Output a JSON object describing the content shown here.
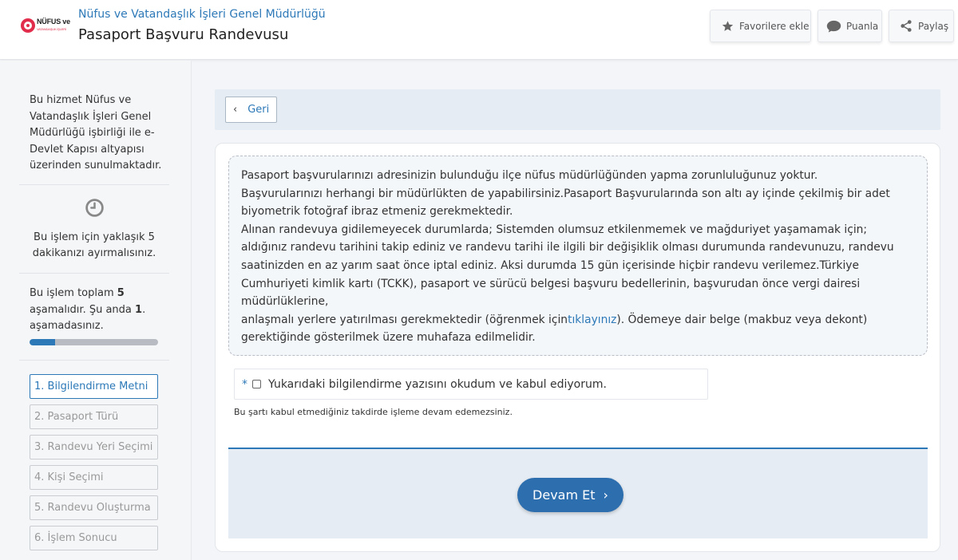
{
  "header": {
    "logo_text": "NÜFUS ve",
    "logo_sub": "VATANDAŞLIK İŞLERİ",
    "org": "Nüfus ve Vatandaşlık İşleri Genel Müdürlüğü",
    "title": "Pasaport Başvuru Randevusu",
    "buttons": {
      "favorite": "Favorilere ekle",
      "rate": "Puanla",
      "share": "Paylaş"
    }
  },
  "sidebar": {
    "service_info": "Bu hizmet Nüfus ve Vatandaşlık İşleri Genel Müdürlüğü işbirliği ile e-Devlet Kapısı altyapısı üzerinden sunulmaktadır.",
    "time_info": "Bu işlem için yaklaşık 5 dakikanızı ayırmalısınız.",
    "stage_info": {
      "prefix": "Bu işlem toplam ",
      "total": "5",
      "middle": " aşamalıdır. Şu anda ",
      "current": "1",
      "suffix": ". aşamadasınız."
    },
    "progress_fraction": 0.2,
    "steps": [
      "1. Bilgilendirme Metni",
      "2. Pasaport Türü",
      "3. Randevu Yeri Seçimi",
      "4. Kişi Seçimi",
      "5. Randevu Oluşturma",
      "6. İşlem Sonucu"
    ],
    "active_step": 0
  },
  "main": {
    "back_label": "Geri",
    "notice": {
      "lines": [
        "Pasaport başvurularınızı adresinizin bulunduğu ilçe nüfus müdürlüğünden yapma zorunluluğunuz yoktur.",
        "Başvurularınızı herhangi bir müdürlükten de yapabilirsiniz.Pasaport Başvurularında son altı ay içinde çekilmiş bir adet",
        "biyometrik fotoğraf ibraz etmeniz gerekmektedir.",
        "Alınan randevuya gidilemeyecek durumlarda; Sistemden olumsuz etkilenmemek ve mağduriyet yaşamamak için;",
        "aldığınız randevu tarihini takip ediniz ve randevu tarihi ile ilgili bir değişiklik olması durumunda randevunuzu, randevu",
        "saatinizden en az yarım saat önce iptal ediniz. Aksi durumda 15 gün içerisinde hiçbir randevu verilemez.Türkiye",
        "Cumhuriyeti kimlik kartı (TCKK), pasaport ve sürücü belgesi başvuru bedellerinin, başvurudan önce vergi dairesi",
        "müdürlüklerine,"
      ],
      "last_line_prefix": "anlaşmalı yerlere yatırılması gerekmektedir (öğrenmek için",
      "link_text": "tıklayınız",
      "last_line_suffix": "). Ödemeye dair belge (makbuz veya dekont)",
      "final_line": "gerektiğinde gösterilmek üzere muhafaza edilmelidir."
    },
    "required_mark": "*",
    "agree_label": "Yukarıdaki bilgilendirme yazısını okudum ve kabul ediyorum.",
    "warning": "Bu şartı kabul etmediğiniz takdirde işleme devam edemezsiniz.",
    "continue_label": "Devam Et"
  },
  "colors": {
    "accent": "#2d79b8",
    "button": "#2d6eaf",
    "logo_red": "#e12d4b"
  },
  "icons": {
    "favorite": "star-icon",
    "rate": "speech-bubble-icon",
    "share": "share-icon",
    "time": "clock-icon",
    "back": "chevron-left-icon",
    "continue": "chevron-right-icon"
  }
}
